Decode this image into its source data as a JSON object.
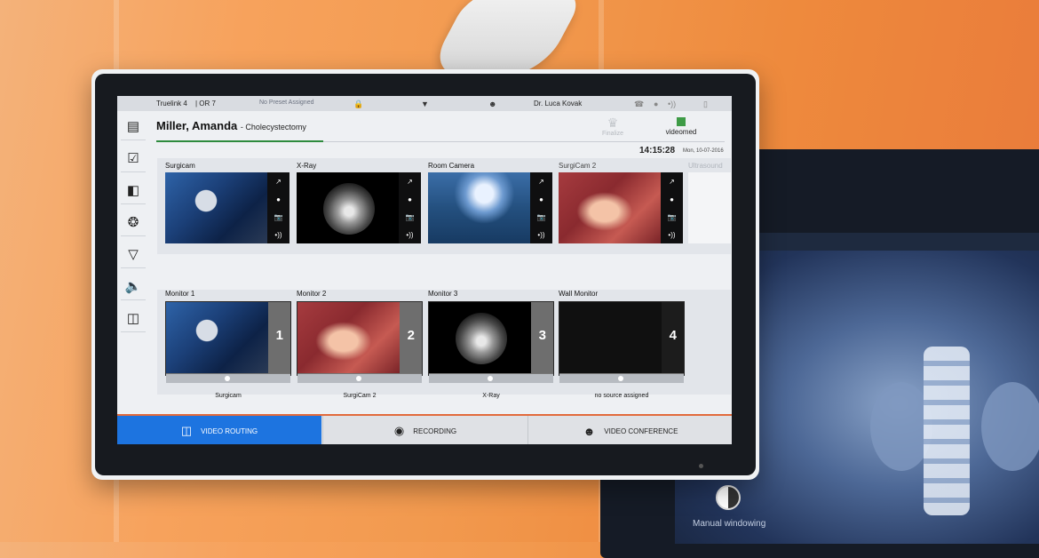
{
  "statusbar": {
    "device": "Truelink 4",
    "room": "| OR 7",
    "preset": "No Preset Assigned",
    "user": "Dr. Luca Kovak"
  },
  "patient": {
    "name": "Miller, Amanda",
    "procedure": "- Cholecystectomy"
  },
  "header": {
    "finalize_label": "Finalize",
    "logo_text": "videomed",
    "time": "14:15:28",
    "date": "Mon, 10-07-2016"
  },
  "sources": [
    {
      "label": "Surgicam"
    },
    {
      "label": "X-Ray"
    },
    {
      "label": "Room Camera"
    },
    {
      "label": "SurgiCam 2"
    },
    {
      "label": "Ultrasound"
    }
  ],
  "monitors": [
    {
      "label": "Monitor 1",
      "number": "1",
      "source": "Surgicam"
    },
    {
      "label": "Monitor 2",
      "number": "2",
      "source": "SurgiCam 2"
    },
    {
      "label": "Monitor 3",
      "number": "3",
      "source": "X-Ray"
    },
    {
      "label": "Wall Monitor",
      "number": "4",
      "source": "no source assigned"
    }
  ],
  "bottomnav": {
    "video_routing": "VIDEO ROUTING",
    "recording": "RECORDING",
    "video_conference": "VIDEO CONFERENCE"
  },
  "background": {
    "monitor_label": "Manual windowing"
  },
  "colors": {
    "accent_blue": "#1d74e0",
    "progress_green": "#2e8b3e",
    "nav_border": "#e26a3b"
  }
}
